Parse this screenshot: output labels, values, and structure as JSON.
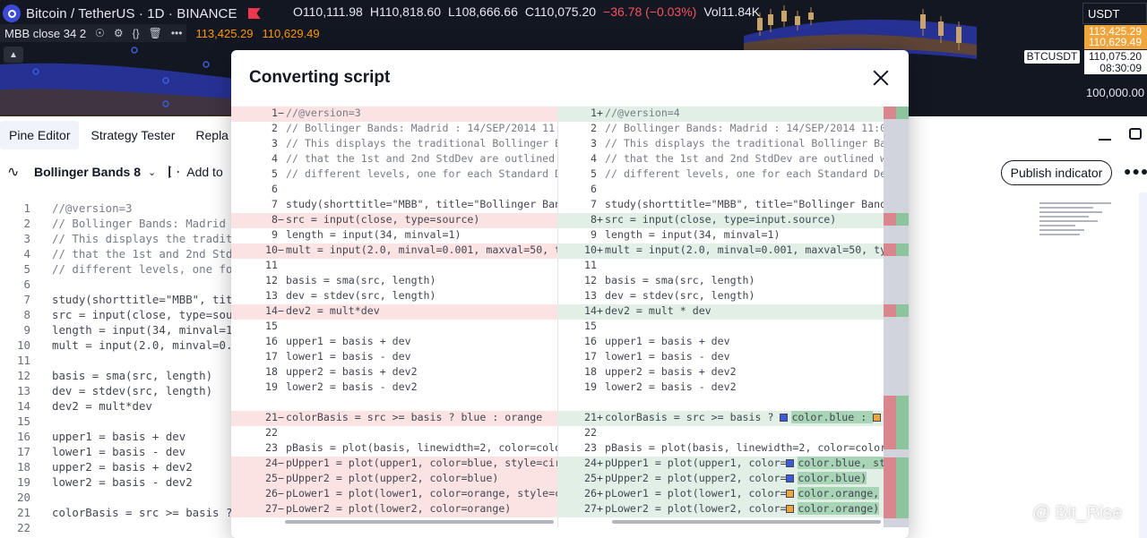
{
  "chart": {
    "symbol_title": "Bitcoin / TetherUS · 1D · BINANCE",
    "ohlc": {
      "open_label": "O",
      "open": "110,111.98",
      "high_label": "H",
      "high": "110,818.60",
      "low_label": "L",
      "low": "108,666.66",
      "close_label": "C",
      "close": "110,075.20",
      "change": "−36.78 (−0.03%)",
      "vol_label": "Vol",
      "vol": "11.84K"
    },
    "indicator_label": "MBB close 34 2",
    "indicator_values": [
      "113,425.29",
      "110,629.49"
    ],
    "collapse_icon": "chevron-up-icon",
    "currency": "USDT",
    "axis_tags": {
      "upper": "113,425.29",
      "lower": "110,629.49",
      "last": "110,075.20",
      "countdown": "08:30:09",
      "symbol": "BTCUSDT",
      "level": "100,000.00"
    },
    "colors": {
      "blue_band": "#2f3fb8",
      "orange": "#ff9800",
      "red": "#f2364d"
    }
  },
  "tabs": [
    {
      "label": "Pine Editor",
      "active": true
    },
    {
      "label": "Strategy Tester",
      "active": false
    },
    {
      "label": "Repla",
      "active": false
    }
  ],
  "toolbar": {
    "script_name": "Bollinger Bands 8",
    "add_to_label": "Add to",
    "publish_label": "Publish indicator"
  },
  "editor": {
    "lines": [
      {
        "n": "1",
        "t": "//@version=3"
      },
      {
        "n": "2",
        "t": "// Bollinger Bands: Madrid"
      },
      {
        "n": "3",
        "t": "// This displays the tradit"
      },
      {
        "n": "4",
        "t": "// that the 1st and 2nd Std"
      },
      {
        "n": "5",
        "t": "// different levels, one fo"
      },
      {
        "n": "6",
        "t": ""
      },
      {
        "n": "7",
        "t": "study(shorttitle=\"MBB\", tit"
      },
      {
        "n": "8",
        "t": "src = input(close, type=sou"
      },
      {
        "n": "9",
        "t": "length = input(34, minval=1"
      },
      {
        "n": "10",
        "t": "mult = input(2.0, minval=0."
      },
      {
        "n": "11",
        "t": ""
      },
      {
        "n": "12",
        "t": "basis = sma(src, length)"
      },
      {
        "n": "13",
        "t": "dev = stdev(src, length)"
      },
      {
        "n": "14",
        "t": "dev2 = mult*dev"
      },
      {
        "n": "15",
        "t": ""
      },
      {
        "n": "16",
        "t": "upper1 = basis + dev"
      },
      {
        "n": "17",
        "t": "lower1 = basis - dev"
      },
      {
        "n": "18",
        "t": "upper2 = basis + dev2"
      },
      {
        "n": "19",
        "t": "lower2 = basis - dev2"
      },
      {
        "n": "20",
        "t": ""
      },
      {
        "n": "21",
        "t": "colorBasis = src >= basis ?"
      },
      {
        "n": "22",
        "t": ""
      }
    ]
  },
  "modal": {
    "title": "Converting script",
    "left": [
      {
        "n": "1",
        "m": "−",
        "t": "//@version=3",
        "type": "del"
      },
      {
        "n": "2",
        "m": "",
        "t": "// Bollinger Bands: Madrid : 14/SEP/2014 11:0",
        "type": ""
      },
      {
        "n": "3",
        "m": "",
        "t": "// This displays the traditional Bollinger Ba",
        "type": ""
      },
      {
        "n": "4",
        "m": "",
        "t": "// that the 1st and 2nd StdDev are outlined w",
        "type": ""
      },
      {
        "n": "5",
        "m": "",
        "t": "// different levels, one for each Standard De",
        "type": ""
      },
      {
        "n": "6",
        "m": "",
        "t": "",
        "type": ""
      },
      {
        "n": "7",
        "m": "",
        "t": "study(shorttitle=\"MBB\", title=\"Bollinger Band",
        "type": ""
      },
      {
        "n": "8",
        "m": "−",
        "t": "src = input(close, type=source)",
        "type": "del"
      },
      {
        "n": "9",
        "m": "",
        "t": "length = input(34, minval=1)",
        "type": ""
      },
      {
        "n": "10",
        "m": "−",
        "t": "mult = input(2.0, minval=0.001, maxval=50, ty",
        "type": "del"
      },
      {
        "n": "11",
        "m": "",
        "t": "",
        "type": ""
      },
      {
        "n": "12",
        "m": "",
        "t": "basis = sma(src, length)",
        "type": ""
      },
      {
        "n": "13",
        "m": "",
        "t": "dev = stdev(src, length)",
        "type": ""
      },
      {
        "n": "14",
        "m": "−",
        "t": "dev2 = mult*dev",
        "type": "del"
      },
      {
        "n": "15",
        "m": "",
        "t": "",
        "type": ""
      },
      {
        "n": "16",
        "m": "",
        "t": "upper1 = basis + dev",
        "type": ""
      },
      {
        "n": "17",
        "m": "",
        "t": "lower1 = basis - dev",
        "type": ""
      },
      {
        "n": "18",
        "m": "",
        "t": "upper2 = basis + dev2",
        "type": ""
      },
      {
        "n": "19",
        "m": "",
        "t": "lower2 = basis - dev2",
        "type": ""
      },
      {
        "n": "",
        "m": "",
        "t": "",
        "type": ""
      },
      {
        "n": "21",
        "m": "−",
        "t": "colorBasis = src >= basis ? blue : orange",
        "type": "del"
      },
      {
        "n": "22",
        "m": "",
        "t": "",
        "type": ""
      },
      {
        "n": "23",
        "m": "",
        "t": "pBasis = plot(basis, linewidth=2, color=color",
        "type": ""
      },
      {
        "n": "24",
        "m": "−",
        "t": "pUpper1 = plot(upper1, color=blue, style=circ",
        "type": "del"
      },
      {
        "n": "25",
        "m": "−",
        "t": "pUpper2 = plot(upper2, color=blue)",
        "type": "del"
      },
      {
        "n": "26",
        "m": "−",
        "t": "pLower1 = plot(lower1, color=orange, style=ci",
        "type": "del"
      },
      {
        "n": "27",
        "m": "−",
        "t": "pLower2 = plot(lower2, color=orange)",
        "type": "del"
      }
    ],
    "right": [
      {
        "n": "1",
        "m": "+",
        "t": "//@version=4",
        "type": "add"
      },
      {
        "n": "2",
        "m": "",
        "t": "// Bollinger Bands: Madrid : 14/SEP/2014 11:0",
        "type": ""
      },
      {
        "n": "3",
        "m": "",
        "t": "// This displays the traditional Bollinger Ba",
        "type": ""
      },
      {
        "n": "4",
        "m": "",
        "t": "// that the 1st and 2nd StdDev are outlined w",
        "type": ""
      },
      {
        "n": "5",
        "m": "",
        "t": "// different levels, one for each Standard De",
        "type": ""
      },
      {
        "n": "6",
        "m": "",
        "t": "",
        "type": ""
      },
      {
        "n": "7",
        "m": "",
        "t": "study(shorttitle=\"MBB\", title=\"Bollinger Band",
        "type": ""
      },
      {
        "n": "8",
        "m": "+",
        "t": "src = input(close, type=input.source)",
        "type": "add"
      },
      {
        "n": "9",
        "m": "",
        "t": "length = input(34, minval=1)",
        "type": ""
      },
      {
        "n": "10",
        "m": "+",
        "t": "mult = input(2.0, minval=0.001, maxval=50, ty",
        "type": "add"
      },
      {
        "n": "11",
        "m": "",
        "t": "",
        "type": ""
      },
      {
        "n": "12",
        "m": "",
        "t": "basis = sma(src, length)",
        "type": ""
      },
      {
        "n": "13",
        "m": "",
        "t": "dev = stdev(src, length)",
        "type": ""
      },
      {
        "n": "14",
        "m": "+",
        "t": "dev2 = mult * dev",
        "type": "add"
      },
      {
        "n": "15",
        "m": "",
        "t": "",
        "type": ""
      },
      {
        "n": "16",
        "m": "",
        "t": "upper1 = basis + dev",
        "type": ""
      },
      {
        "n": "17",
        "m": "",
        "t": "lower1 = basis - dev",
        "type": ""
      },
      {
        "n": "18",
        "m": "",
        "t": "upper2 = basis + dev2",
        "type": ""
      },
      {
        "n": "19",
        "m": "",
        "t": "lower2 = basis - dev2",
        "type": ""
      },
      {
        "n": "",
        "m": "",
        "t": "",
        "type": ""
      },
      {
        "n": "21",
        "m": "+",
        "t": "colorBasis = src >= basis ? ",
        "sq": "blue",
        "t2": "color.blue : ",
        "sq2": "orange",
        "type": "add"
      },
      {
        "n": "22",
        "m": "",
        "t": "",
        "type": ""
      },
      {
        "n": "23",
        "m": "",
        "t": "pBasis = plot(basis, linewidth=2, color=color",
        "type": ""
      },
      {
        "n": "24",
        "m": "+",
        "t": "pUpper1 = plot(upper1, color=",
        "sq": "blue",
        "t2": "color.blue, st",
        "type": "add"
      },
      {
        "n": "25",
        "m": "+",
        "t": "pUpper2 = plot(upper2, color=",
        "sq": "blue",
        "t2": "color.blue)",
        "type": "add"
      },
      {
        "n": "26",
        "m": "+",
        "t": "pLower1 = plot(lower1, color=",
        "sq": "orange",
        "t2": "color.orange,",
        "type": "add"
      },
      {
        "n": "27",
        "m": "+",
        "t": "pLower2 = plot(lower2, color=",
        "sq": "orange",
        "t2": "color.orange)",
        "type": "add"
      }
    ]
  },
  "watermark": "@ Bit_Rise"
}
